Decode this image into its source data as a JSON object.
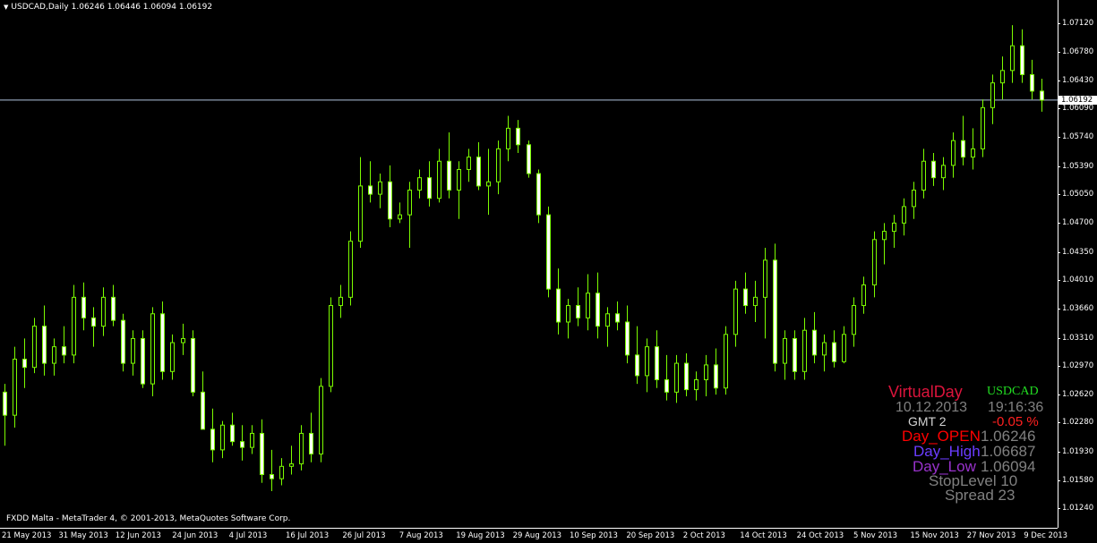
{
  "header": {
    "symbol": "USDCAD,Daily",
    "ohlc": "1.06246 1.06446 1.06094 1.06192"
  },
  "copyright": "FXDD Malta - MetaTrader 4, © 2001-2013, MetaQuotes Software Corp.",
  "current_price": "1.06192",
  "colors": {
    "background": "#000000",
    "candle": "#7cfc00",
    "bull_body": "#000000",
    "bear_body": "#ffffff",
    "price_line": "#b0c4de"
  },
  "indicator": {
    "title": "VirtualDay",
    "symbol": "USDCAD",
    "date": "10.12.2013",
    "time": "19:16:36",
    "gmt": "GMT 2",
    "change": "-0.05 %",
    "open_label": "Day_OPEN",
    "open_value": "1.06246",
    "high_label": "Day_High",
    "high_value": "1.06687",
    "low_label": "Day_Low",
    "low_value": "1.06094",
    "stoplevel": "StopLevel 10",
    "spread": "Spread  23"
  },
  "chart_data": {
    "type": "candlestick",
    "title": "USDCAD,Daily",
    "ylim": [
      1.0107,
      1.0734
    ],
    "y_ticks": [
      "1.07120",
      "1.06780",
      "1.06430",
      "1.06090",
      "1.05740",
      "1.05390",
      "1.05050",
      "1.04700",
      "1.04350",
      "1.04010",
      "1.03660",
      "1.03310",
      "1.02970",
      "1.02620",
      "1.02280",
      "1.01930",
      "1.01580",
      "1.01240"
    ],
    "x_labels": [
      "21 May 2013",
      "31 May 2013",
      "12 Jun 2013",
      "24 Jun 2013",
      "4 Jul 2013",
      "16 Jul 2013",
      "26 Jul 2013",
      "7 Aug 2013",
      "19 Aug 2013",
      "29 Aug 2013",
      "10 Sep 2013",
      "20 Sep 2013",
      "2 Oct 2013",
      "14 Oct 2013",
      "24 Oct 2013",
      "5 Nov 2013",
      "15 Nov 2013",
      "27 Nov 2013",
      "9 Dec 2013"
    ],
    "candles": [
      {
        "o": 1.0265,
        "h": 1.0275,
        "l": 1.02,
        "c": 1.0237
      },
      {
        "o": 1.0237,
        "h": 1.032,
        "l": 1.0222,
        "c": 1.0305
      },
      {
        "o": 1.0305,
        "h": 1.033,
        "l": 1.027,
        "c": 1.0295
      },
      {
        "o": 1.0295,
        "h": 1.0355,
        "l": 1.0288,
        "c": 1.0345
      },
      {
        "o": 1.0345,
        "h": 1.037,
        "l": 1.0285,
        "c": 1.03
      },
      {
        "o": 1.03,
        "h": 1.033,
        "l": 1.0285,
        "c": 1.032
      },
      {
        "o": 1.032,
        "h": 1.0345,
        "l": 1.03,
        "c": 1.031
      },
      {
        "o": 1.031,
        "h": 1.0395,
        "l": 1.03,
        "c": 1.038
      },
      {
        "o": 1.038,
        "h": 1.0398,
        "l": 1.034,
        "c": 1.0355
      },
      {
        "o": 1.0355,
        "h": 1.0368,
        "l": 1.032,
        "c": 1.0345
      },
      {
        "o": 1.0345,
        "h": 1.0392,
        "l": 1.0333,
        "c": 1.038
      },
      {
        "o": 1.038,
        "h": 1.0395,
        "l": 1.0345,
        "c": 1.0352
      },
      {
        "o": 1.0352,
        "h": 1.036,
        "l": 1.029,
        "c": 1.03
      },
      {
        "o": 1.03,
        "h": 1.034,
        "l": 1.0285,
        "c": 1.033
      },
      {
        "o": 1.033,
        "h": 1.034,
        "l": 1.027,
        "c": 1.0275
      },
      {
        "o": 1.0275,
        "h": 1.0368,
        "l": 1.026,
        "c": 1.036
      },
      {
        "o": 1.036,
        "h": 1.0375,
        "l": 1.028,
        "c": 1.029
      },
      {
        "o": 1.029,
        "h": 1.0335,
        "l": 1.028,
        "c": 1.0325
      },
      {
        "o": 1.0325,
        "h": 1.0348,
        "l": 1.031,
        "c": 1.033
      },
      {
        "o": 1.033,
        "h": 1.034,
        "l": 1.026,
        "c": 1.0265
      },
      {
        "o": 1.0265,
        "h": 1.029,
        "l": 1.022,
        "c": 1.022
      },
      {
        "o": 1.022,
        "h": 1.0245,
        "l": 1.018,
        "c": 1.0195
      },
      {
        "o": 1.0195,
        "h": 1.023,
        "l": 1.0185,
        "c": 1.0225
      },
      {
        "o": 1.0225,
        "h": 1.024,
        "l": 1.02,
        "c": 1.0205
      },
      {
        "o": 1.0205,
        "h": 1.0225,
        "l": 1.0182,
        "c": 1.0198
      },
      {
        "o": 1.0198,
        "h": 1.0225,
        "l": 1.019,
        "c": 1.0215
      },
      {
        "o": 1.0215,
        "h": 1.0232,
        "l": 1.0155,
        "c": 1.0165
      },
      {
        "o": 1.0165,
        "h": 1.0195,
        "l": 1.0145,
        "c": 1.016
      },
      {
        "o": 1.016,
        "h": 1.0185,
        "l": 1.0152,
        "c": 1.0175
      },
      {
        "o": 1.0175,
        "h": 1.02,
        "l": 1.0165,
        "c": 1.0178
      },
      {
        "o": 1.0178,
        "h": 1.0225,
        "l": 1.017,
        "c": 1.0215
      },
      {
        "o": 1.0215,
        "h": 1.024,
        "l": 1.018,
        "c": 1.019
      },
      {
        "o": 1.019,
        "h": 1.0282,
        "l": 1.018,
        "c": 1.0272
      },
      {
        "o": 1.0272,
        "h": 1.038,
        "l": 1.0265,
        "c": 1.037
      },
      {
        "o": 1.037,
        "h": 1.0395,
        "l": 1.0355,
        "c": 1.038
      },
      {
        "o": 1.038,
        "h": 1.046,
        "l": 1.037,
        "c": 1.0448
      },
      {
        "o": 1.0448,
        "h": 1.055,
        "l": 1.044,
        "c": 1.0515
      },
      {
        "o": 1.0515,
        "h": 1.0545,
        "l": 1.0495,
        "c": 1.0505
      },
      {
        "o": 1.0505,
        "h": 1.053,
        "l": 1.0488,
        "c": 1.052
      },
      {
        "o": 1.052,
        "h": 1.054,
        "l": 1.0465,
        "c": 1.0475
      },
      {
        "o": 1.0475,
        "h": 1.0495,
        "l": 1.047,
        "c": 1.048
      },
      {
        "o": 1.048,
        "h": 1.052,
        "l": 1.044,
        "c": 1.051
      },
      {
        "o": 1.051,
        "h": 1.0535,
        "l": 1.05,
        "c": 1.0525
      },
      {
        "o": 1.0525,
        "h": 1.0545,
        "l": 1.049,
        "c": 1.05
      },
      {
        "o": 1.05,
        "h": 1.056,
        "l": 1.0495,
        "c": 1.0545
      },
      {
        "o": 1.0545,
        "h": 1.058,
        "l": 1.05,
        "c": 1.051
      },
      {
        "o": 1.051,
        "h": 1.0545,
        "l": 1.0475,
        "c": 1.0535
      },
      {
        "o": 1.0535,
        "h": 1.056,
        "l": 1.052,
        "c": 1.055
      },
      {
        "o": 1.055,
        "h": 1.0568,
        "l": 1.051,
        "c": 1.0515
      },
      {
        "o": 1.0515,
        "h": 1.056,
        "l": 1.048,
        "c": 1.052
      },
      {
        "o": 1.052,
        "h": 1.057,
        "l": 1.0505,
        "c": 1.056
      },
      {
        "o": 1.056,
        "h": 1.06,
        "l": 1.0545,
        "c": 1.0585
      },
      {
        "o": 1.0585,
        "h": 1.0595,
        "l": 1.0555,
        "c": 1.0565
      },
      {
        "o": 1.0565,
        "h": 1.057,
        "l": 1.0525,
        "c": 1.053
      },
      {
        "o": 1.053,
        "h": 1.0535,
        "l": 1.047,
        "c": 1.048
      },
      {
        "o": 1.048,
        "h": 1.049,
        "l": 1.038,
        "c": 1.039
      },
      {
        "o": 1.039,
        "h": 1.0415,
        "l": 1.0335,
        "c": 1.035
      },
      {
        "o": 1.035,
        "h": 1.0378,
        "l": 1.033,
        "c": 1.037
      },
      {
        "o": 1.037,
        "h": 1.0392,
        "l": 1.0345,
        "c": 1.0355
      },
      {
        "o": 1.0355,
        "h": 1.0408,
        "l": 1.034,
        "c": 1.0385
      },
      {
        "o": 1.0385,
        "h": 1.041,
        "l": 1.033,
        "c": 1.0345
      },
      {
        "o": 1.0345,
        "h": 1.0368,
        "l": 1.032,
        "c": 1.036
      },
      {
        "o": 1.036,
        "h": 1.0375,
        "l": 1.034,
        "c": 1.035
      },
      {
        "o": 1.035,
        "h": 1.037,
        "l": 1.03,
        "c": 1.031
      },
      {
        "o": 1.031,
        "h": 1.0345,
        "l": 1.0275,
        "c": 1.0285
      },
      {
        "o": 1.0285,
        "h": 1.033,
        "l": 1.0265,
        "c": 1.032
      },
      {
        "o": 1.032,
        "h": 1.034,
        "l": 1.027,
        "c": 1.028
      },
      {
        "o": 1.028,
        "h": 1.031,
        "l": 1.0255,
        "c": 1.0265
      },
      {
        "o": 1.0265,
        "h": 1.031,
        "l": 1.0252,
        "c": 1.03
      },
      {
        "o": 1.03,
        "h": 1.0312,
        "l": 1.026,
        "c": 1.0268
      },
      {
        "o": 1.0268,
        "h": 1.029,
        "l": 1.0255,
        "c": 1.028
      },
      {
        "o": 1.028,
        "h": 1.031,
        "l": 1.026,
        "c": 1.0298
      },
      {
        "o": 1.0298,
        "h": 1.0318,
        "l": 1.0262,
        "c": 1.027
      },
      {
        "o": 1.027,
        "h": 1.0345,
        "l": 1.0262,
        "c": 1.0335
      },
      {
        "o": 1.0335,
        "h": 1.04,
        "l": 1.032,
        "c": 1.039
      },
      {
        "o": 1.039,
        "h": 1.041,
        "l": 1.036,
        "c": 1.037
      },
      {
        "o": 1.037,
        "h": 1.04,
        "l": 1.035,
        "c": 1.038
      },
      {
        "o": 1.038,
        "h": 1.044,
        "l": 1.033,
        "c": 1.0425
      },
      {
        "o": 1.0425,
        "h": 1.0445,
        "l": 1.029,
        "c": 1.03
      },
      {
        "o": 1.03,
        "h": 1.034,
        "l": 1.028,
        "c": 1.033
      },
      {
        "o": 1.033,
        "h": 1.034,
        "l": 1.028,
        "c": 1.029
      },
      {
        "o": 1.029,
        "h": 1.0355,
        "l": 1.028,
        "c": 1.034
      },
      {
        "o": 1.034,
        "h": 1.0362,
        "l": 1.03,
        "c": 1.031
      },
      {
        "o": 1.031,
        "h": 1.0335,
        "l": 1.029,
        "c": 1.0325
      },
      {
        "o": 1.0325,
        "h": 1.034,
        "l": 1.0295,
        "c": 1.0302
      },
      {
        "o": 1.0302,
        "h": 1.0345,
        "l": 1.03,
        "c": 1.0335
      },
      {
        "o": 1.0335,
        "h": 1.038,
        "l": 1.032,
        "c": 1.037
      },
      {
        "o": 1.037,
        "h": 1.0405,
        "l": 1.036,
        "c": 1.0395
      },
      {
        "o": 1.0395,
        "h": 1.046,
        "l": 1.038,
        "c": 1.045
      },
      {
        "o": 1.045,
        "h": 1.047,
        "l": 1.042,
        "c": 1.046
      },
      {
        "o": 1.046,
        "h": 1.048,
        "l": 1.044,
        "c": 1.047
      },
      {
        "o": 1.047,
        "h": 1.05,
        "l": 1.0455,
        "c": 1.049
      },
      {
        "o": 1.049,
        "h": 1.052,
        "l": 1.0475,
        "c": 1.051
      },
      {
        "o": 1.051,
        "h": 1.056,
        "l": 1.05,
        "c": 1.0545
      },
      {
        "o": 1.0545,
        "h": 1.0555,
        "l": 1.0515,
        "c": 1.0525
      },
      {
        "o": 1.0525,
        "h": 1.055,
        "l": 1.051,
        "c": 1.054
      },
      {
        "o": 1.054,
        "h": 1.058,
        "l": 1.0525,
        "c": 1.057
      },
      {
        "o": 1.057,
        "h": 1.06,
        "l": 1.054,
        "c": 1.055
      },
      {
        "o": 1.055,
        "h": 1.0585,
        "l": 1.0535,
        "c": 1.056
      },
      {
        "o": 1.056,
        "h": 1.062,
        "l": 1.055,
        "c": 1.061
      },
      {
        "o": 1.061,
        "h": 1.065,
        "l": 1.059,
        "c": 1.064
      },
      {
        "o": 1.064,
        "h": 1.0672,
        "l": 1.062,
        "c": 1.0655
      },
      {
        "o": 1.0655,
        "h": 1.071,
        "l": 1.064,
        "c": 1.0685
      },
      {
        "o": 1.0685,
        "h": 1.0705,
        "l": 1.064,
        "c": 1.065
      },
      {
        "o": 1.065,
        "h": 1.0668,
        "l": 1.062,
        "c": 1.063
      },
      {
        "o": 1.063,
        "h": 1.0645,
        "l": 1.0605,
        "c": 1.0619
      }
    ]
  }
}
